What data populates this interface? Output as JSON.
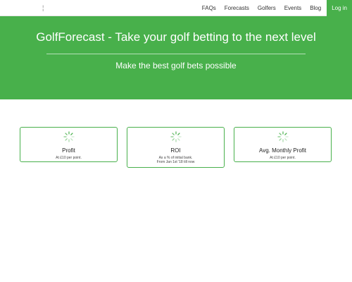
{
  "nav": {
    "brand_mark": "¦",
    "links": [
      "FAQs",
      "Forecasts",
      "Golfers",
      "Events",
      "Blog"
    ],
    "login": "Log in"
  },
  "hero": {
    "title": "GolfForecast - Take your golf betting to the next level",
    "subtitle": "Make the best golf bets possible"
  },
  "cards": [
    {
      "title": "Profit",
      "note": "At £10 per point."
    },
    {
      "title": "ROI",
      "note": "As a % of initial bank.",
      "note2": "From Jan 1st '18 till now"
    },
    {
      "title": "Avg. Monthly Profit",
      "note": "At £10 per point."
    }
  ],
  "colors": {
    "accent": "#48b04b",
    "spinner": "#48b04b"
  },
  "icons": {
    "loading": "loading-spinner-icon"
  }
}
